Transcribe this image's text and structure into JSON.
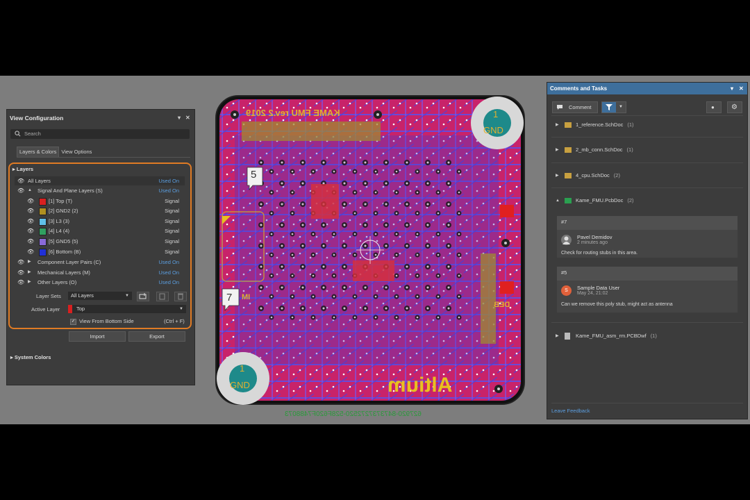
{
  "view_config": {
    "title": "View Configuration",
    "search_placeholder": "Search",
    "tabs": [
      "Layers & Colors",
      "View Options"
    ],
    "layers_section": "Layers",
    "all_layers": {
      "label": "All Layers",
      "status": "Used On"
    },
    "signal_group": {
      "label": "Signal And Plane Layers (S)",
      "status": "Used On"
    },
    "signal_layers": [
      {
        "label": "[1] Top (T)",
        "type": "Signal",
        "color": "#d82020"
      },
      {
        "label": "[2] GND2 (2)",
        "type": "Signal",
        "color": "#b09020"
      },
      {
        "label": "[3] L3 (3)",
        "type": "Signal",
        "color": "#60c0e8"
      },
      {
        "label": "[4] L4 (4)",
        "type": "Signal",
        "color": "#30a060"
      },
      {
        "label": "[5] GND5 (5)",
        "type": "Signal",
        "color": "#8a6ad8"
      },
      {
        "label": "[6] Bottom (B)",
        "type": "Signal",
        "color": "#2030d8"
      }
    ],
    "groups": [
      {
        "label": "Component Layer Pairs (C)",
        "status": "Used On"
      },
      {
        "label": "Mechanical Layers (M)",
        "status": "Used On"
      },
      {
        "label": "Other Layers (O)",
        "status": "Used On"
      }
    ],
    "layer_sets_label": "Layer Sets",
    "layer_sets_value": "All Layers",
    "active_layer_label": "Active Layer",
    "active_layer_value": "Top",
    "view_bottom_label": "View From Bottom Side",
    "view_bottom_shortcut": "(Ctrl + F)",
    "import_label": "Import",
    "export_label": "Export",
    "system_colors": "System Colors"
  },
  "pcb": {
    "title_text": "KAME FMU rev.2 2019",
    "corner_label_num": "1",
    "corner_label_gnd": "GND",
    "marker_5": "5",
    "marker_7": "7",
    "logo": "Altium",
    "serial": "627920-8473737272520-528F620F7488073",
    "side_text_deb": "DEB",
    "side_text_mi": "MI"
  },
  "comments": {
    "title": "Comments and Tasks",
    "comment_button": "Comment",
    "docs": [
      {
        "name": "1_reference.SchDoc",
        "count": "(1)"
      },
      {
        "name": "2_mb_conn.SchDoc",
        "count": "(1)"
      },
      {
        "name": "4_cpu.SchDoc",
        "count": "(2)"
      },
      {
        "name": "Kame_FMU.PcbDoc",
        "count": "(2)"
      }
    ],
    "threads": [
      {
        "num": "#7",
        "author": "Pavel Demidov",
        "time": "2 minutes ago",
        "text": "Check for routing stubs in this area."
      },
      {
        "num": "#5",
        "author": "Sample Data User",
        "time": "May 24, 21:02",
        "text": "Can we remove this poly stub, might act as antenna",
        "avatar_letter": "S"
      }
    ],
    "last_doc": {
      "name": "Kame_FMU_asm_rm.PCBDwf",
      "count": "(1)"
    },
    "feedback": "Leave Feedback"
  }
}
